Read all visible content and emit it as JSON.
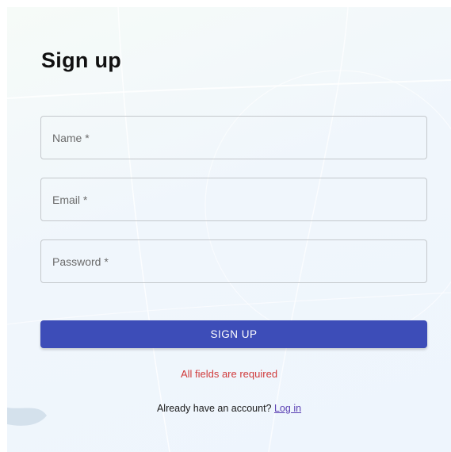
{
  "form": {
    "title": "Sign up",
    "fields": {
      "name": {
        "placeholder": "Name *",
        "value": ""
      },
      "email": {
        "placeholder": "Email *",
        "value": ""
      },
      "password": {
        "placeholder": "Password *",
        "value": ""
      }
    },
    "submit_label": "SIGN UP",
    "error_message": "All fields are required",
    "login_prompt": "Already have an account?",
    "login_link": "Log in"
  },
  "colors": {
    "accent": "#3d4db8",
    "error": "#d03a3a",
    "link": "#5a3fb3"
  }
}
